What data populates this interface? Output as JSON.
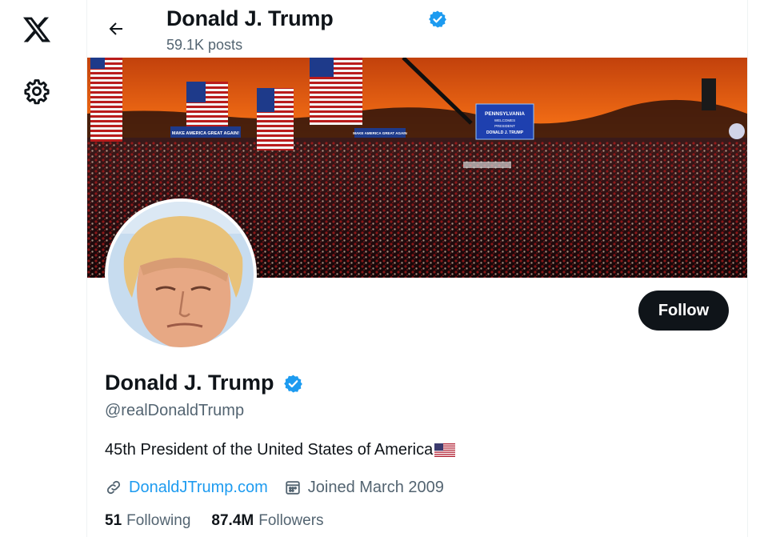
{
  "nav": {
    "logo_icon": "x-logo-icon",
    "settings_icon": "gear-icon"
  },
  "header": {
    "back_icon": "arrow-left-icon",
    "name": "Donald J. Trump",
    "posts_count": "59.1K posts",
    "verified_icon": "verified-badge-icon"
  },
  "banner": {
    "signs": [
      "MAKE AMERICA GREAT AGAIN!",
      "MAKE AMERICA GREAT AGAIN",
      "PENNSYLVANIA",
      "WELCOMES",
      "PRESIDENT",
      "DONALD J. TRUMP"
    ]
  },
  "profile": {
    "follow_label": "Follow",
    "name": "Donald J. Trump",
    "handle": "@realDonaldTrump",
    "bio": "45th President of the United States of America",
    "website": "DonaldJTrump.com",
    "joined": "Joined March 2009",
    "following_count": "51",
    "following_label": "Following",
    "followers_count": "87.4M",
    "followers_label": "Followers"
  },
  "colors": {
    "accent": "#1d9bf0",
    "text": "#0f1419",
    "muted": "#536471",
    "button": "#0f1419"
  }
}
